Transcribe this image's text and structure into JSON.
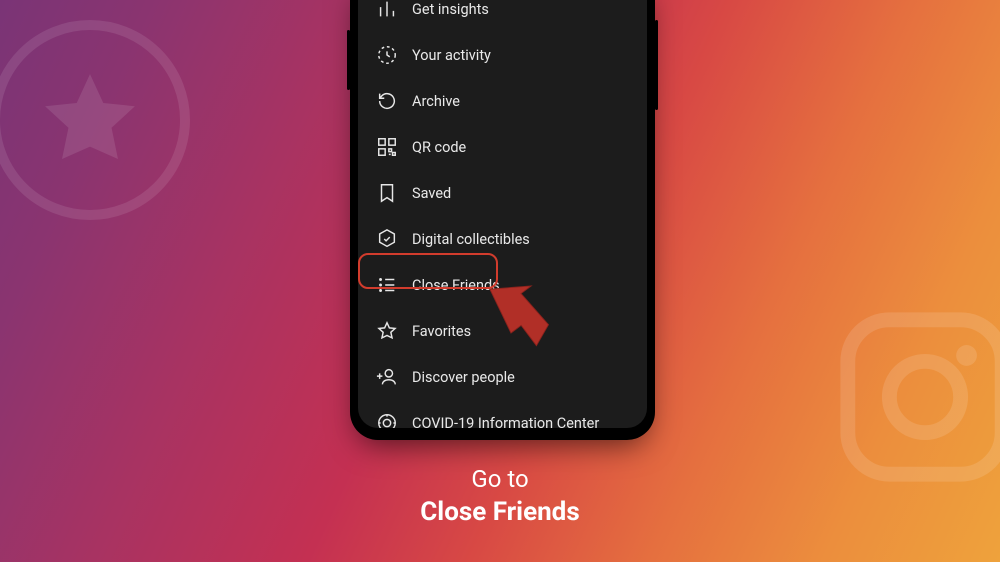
{
  "menu": {
    "items": [
      {
        "label": "Get insights"
      },
      {
        "label": "Your activity"
      },
      {
        "label": "Archive"
      },
      {
        "label": "QR code"
      },
      {
        "label": "Saved"
      },
      {
        "label": "Digital collectibles"
      },
      {
        "label": "Close Friends"
      },
      {
        "label": "Favorites"
      },
      {
        "label": "Discover people"
      },
      {
        "label": "COVID-19 Information Center"
      }
    ]
  },
  "caption": {
    "line1": "Go to",
    "line2": "Close Friends"
  },
  "colors": {
    "highlight": "#d23c2d",
    "arrow": "#b12f27"
  }
}
